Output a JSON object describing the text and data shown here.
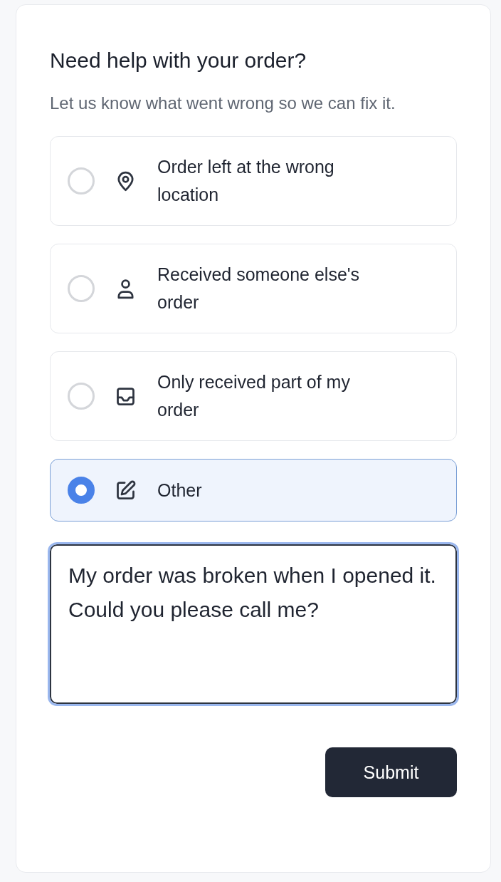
{
  "title": "Need help with your order?",
  "subtitle": "Let us know what went wrong so we can fix it.",
  "options": [
    {
      "kind": "location",
      "label": "Order left at the wrong location",
      "selected": false
    },
    {
      "kind": "person",
      "label": "Received someone else's order",
      "selected": false
    },
    {
      "kind": "inbox",
      "label": "Only received part of my order",
      "selected": false
    },
    {
      "kind": "edit",
      "label": "Other",
      "selected": true
    }
  ],
  "message": {
    "value": "My order was broken when I opened it. Could you please call me?"
  },
  "submit": "Submit"
}
